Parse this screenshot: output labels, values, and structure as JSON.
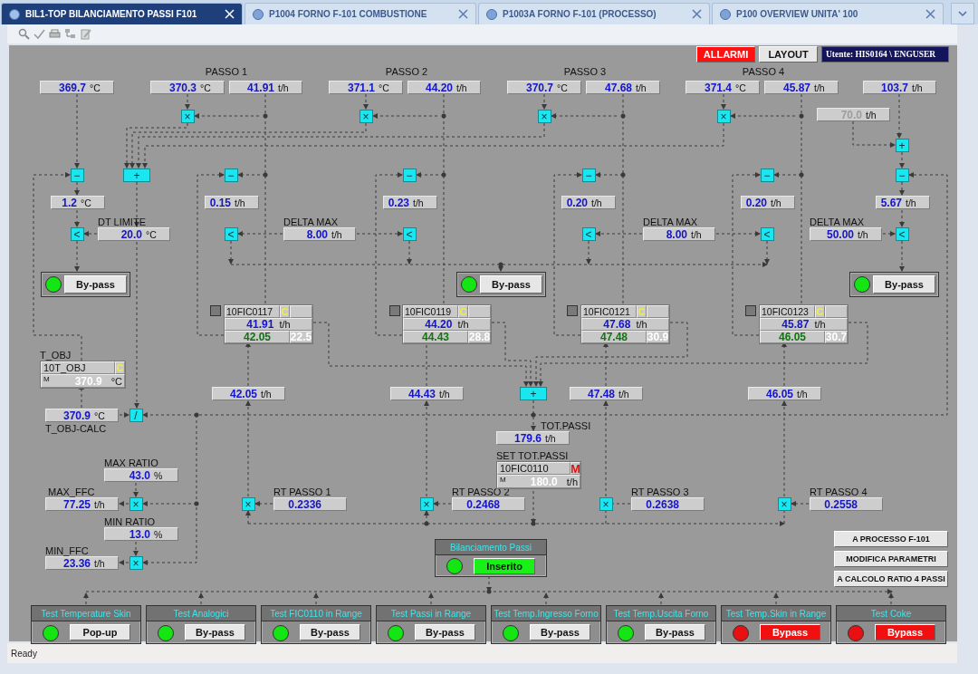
{
  "tabs": [
    {
      "label": "BIL1-TOP BILANCIAMENTO PASSI F101",
      "selected": true
    },
    {
      "label": "P1004 FORNO F-101 COMBUSTIONE",
      "selected": false
    },
    {
      "label": "P1003A FORNO F-101 (PROCESSO)",
      "selected": false
    },
    {
      "label": "P100 OVERVIEW UNITA' 100",
      "selected": false
    }
  ],
  "header": {
    "buttons": [
      {
        "label": "ALLARMI",
        "alarm": true
      },
      {
        "label": "LAYOUT",
        "alarm": false
      }
    ],
    "user": "Utente: HIS0164 \\ ENGUSER"
  },
  "pass_titles": [
    "PASSO 1",
    "PASSO 2",
    "PASSO 3",
    "PASSO 4"
  ],
  "readouts": [
    {
      "value": "369.7",
      "unit": "°C",
      "disabled": false
    },
    {
      "value": "370.3",
      "unit": "°C",
      "disabled": false
    },
    {
      "value": "41.91",
      "unit": "t/h",
      "disabled": false
    },
    {
      "value": "371.1",
      "unit": "°C",
      "disabled": false
    },
    {
      "value": "44.20",
      "unit": "t/h",
      "disabled": false
    },
    {
      "value": "370.7",
      "unit": "°C",
      "disabled": false
    },
    {
      "value": "47.68",
      "unit": "t/h",
      "disabled": false
    },
    {
      "value": "371.4",
      "unit": "°C",
      "disabled": false
    },
    {
      "value": "45.87",
      "unit": "t/h",
      "disabled": false
    },
    {
      "value": "103.7",
      "unit": "t/h",
      "disabled": false
    },
    {
      "value": "70.0",
      "unit": "t/h",
      "disabled": true
    },
    {
      "value": "1.2",
      "unit": "°C",
      "disabled": false
    },
    {
      "value": "0.15",
      "unit": "t/h",
      "disabled": false
    },
    {
      "value": "0.23",
      "unit": "t/h",
      "disabled": false
    },
    {
      "value": "0.20",
      "unit": "t/h",
      "disabled": false
    },
    {
      "value": "0.20",
      "unit": "t/h",
      "disabled": false
    },
    {
      "value": "5.67",
      "unit": "t/h",
      "disabled": false
    },
    {
      "label": "DT LIMITE",
      "value": "20.0",
      "unit": "°C",
      "disabled": false
    },
    {
      "label": "DELTA MAX",
      "value": "8.00",
      "unit": "t/h",
      "disabled": false
    },
    {
      "label": "DELTA MAX",
      "value": "8.00",
      "unit": "t/h",
      "disabled": false
    },
    {
      "label": "DELTA MAX",
      "value": "50.00",
      "unit": "t/h",
      "disabled": false
    },
    {
      "value": "42.05",
      "unit": "t/h",
      "disabled": false
    },
    {
      "value": "44.43",
      "unit": "t/h",
      "disabled": false
    },
    {
      "value": "47.48",
      "unit": "t/h",
      "disabled": false
    },
    {
      "value": "46.05",
      "unit": "t/h",
      "disabled": false
    },
    {
      "label": "T_OBJ-CALC",
      "value": "370.9",
      "unit": "°C",
      "disabled": false
    },
    {
      "label": "TOT.PASSI",
      "value": "179.6",
      "unit": "t/h",
      "disabled": false
    },
    {
      "label": "MAX RATIO",
      "value": "43.0",
      "unit": "%",
      "disabled": false
    },
    {
      "label": "MAX_FFC",
      "value": "77.25",
      "unit": "t/h",
      "disabled": false
    },
    {
      "label": "RT PASSO 1",
      "value": "0.2336",
      "disabled": false
    },
    {
      "label": "RT PASSO 2",
      "value": "0.2468",
      "disabled": false
    },
    {
      "label": "RT PASSO 3",
      "value": "0.2638",
      "disabled": false
    },
    {
      "label": "RT PASSO 4",
      "value": "0.2558",
      "disabled": false
    },
    {
      "label": "MIN RATIO",
      "value": "13.0",
      "unit": "%",
      "disabled": false
    },
    {
      "label": "MIN_FFC",
      "value": "23.36",
      "unit": "t/h",
      "disabled": false
    }
  ],
  "blocks": [
    {
      "symbol": "×"
    },
    {
      "symbol": "×"
    },
    {
      "symbol": "×"
    },
    {
      "symbol": "×"
    },
    {
      "symbol": "+"
    },
    {
      "symbol": "−"
    },
    {
      "symbol": "+"
    },
    {
      "symbol": "−"
    },
    {
      "symbol": "−"
    },
    {
      "symbol": "−"
    },
    {
      "symbol": "−"
    },
    {
      "symbol": "−"
    },
    {
      "symbol": "<"
    },
    {
      "symbol": "<"
    },
    {
      "symbol": "<"
    },
    {
      "symbol": "<"
    },
    {
      "symbol": "<"
    },
    {
      "symbol": "<"
    },
    {
      "symbol": "+"
    },
    {
      "symbol": "/"
    },
    {
      "symbol": "×"
    },
    {
      "symbol": "×"
    },
    {
      "symbol": "×"
    },
    {
      "symbol": "×"
    },
    {
      "symbol": "×"
    },
    {
      "symbol": "×"
    }
  ],
  "controllers": [
    {
      "tag": "10FIC0117",
      "mode": "C",
      "mode_manual": false,
      "pv": "41.91",
      "unit": "t/h",
      "sp": "42.05",
      "out": "22.5"
    },
    {
      "tag": "10FIC0119",
      "mode": "C",
      "mode_manual": false,
      "pv": "44.20",
      "unit": "t/h",
      "sp": "44.43",
      "out": "28.8"
    },
    {
      "tag": "10FIC0121",
      "mode": "C",
      "mode_manual": false,
      "pv": "47.68",
      "unit": "t/h",
      "sp": "47.48",
      "out": "30.9"
    },
    {
      "tag": "10FIC0123",
      "mode": "C",
      "mode_manual": false,
      "pv": "45.87",
      "unit": "t/h",
      "sp": "46.05",
      "out": "30.7"
    }
  ],
  "targets": [
    {
      "label": "T_OBJ",
      "tag": "10T_OBJ",
      "mode": "C",
      "mode_manual": false,
      "mode_small": "M",
      "value": "370.9",
      "unit": "°C"
    },
    {
      "label": "SET TOT.PASSI",
      "tag": "10FIC0110",
      "mode": "M",
      "mode_manual": true,
      "mode_small": "M",
      "value": "180.0",
      "unit": "t/h"
    }
  ],
  "bypass_panels": [
    {
      "on": true,
      "button": "By-pass"
    },
    {
      "on": true,
      "button": "By-pass"
    },
    {
      "on": true,
      "button": "By-pass"
    }
  ],
  "balance_panel": {
    "title": "Bilanciamento Passi",
    "on": true,
    "button": "Inserito"
  },
  "actions": [
    "A PROCESSO F-101",
    "MODIFICA PARAMETRI",
    "A CALCOLO RATIO 4 PASSI"
  ],
  "tests": [
    {
      "title": "Test Temperature Skin",
      "on": true,
      "button": "Pop-up"
    },
    {
      "title": "Test Analogici",
      "on": true,
      "button": "By-pass"
    },
    {
      "title": "Test FIC0110 in Range",
      "on": true,
      "button": "By-pass"
    },
    {
      "title": "Test Passi in Range",
      "on": true,
      "button": "By-pass"
    },
    {
      "title": "Test Temp.Ingresso Forno",
      "on": true,
      "button": "By-pass"
    },
    {
      "title": "Test Temp.Uscita Forno",
      "on": true,
      "button": "By-pass"
    },
    {
      "title": "Test Temp.Skin in Range",
      "on": false,
      "button": "Bypass"
    },
    {
      "title": "Test Coke",
      "on": false,
      "button": "Bypass"
    }
  ],
  "status_bar": "Ready"
}
